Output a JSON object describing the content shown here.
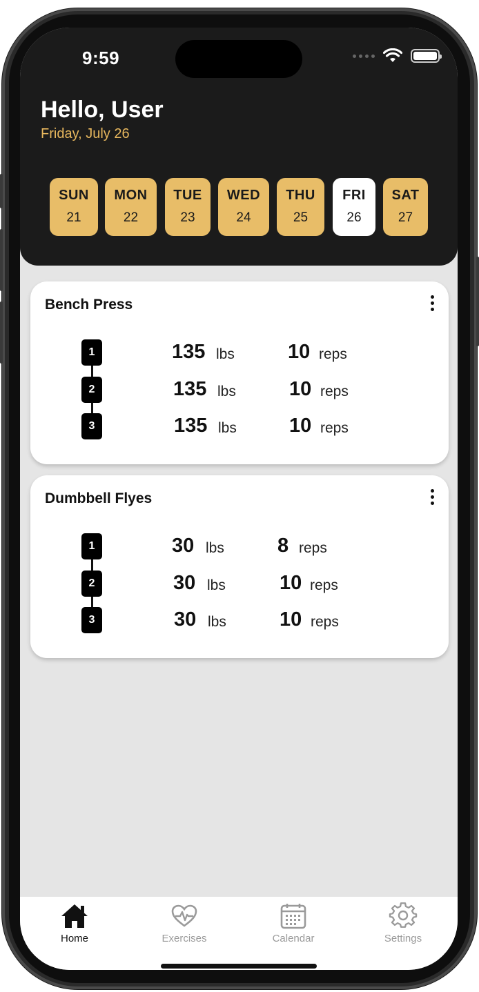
{
  "status": {
    "time": "9:59"
  },
  "header": {
    "greeting": "Hello, User",
    "date": "Friday, July 26"
  },
  "days": [
    {
      "name": "SUN",
      "num": "21"
    },
    {
      "name": "MON",
      "num": "22"
    },
    {
      "name": "TUE",
      "num": "23"
    },
    {
      "name": "WED",
      "num": "24"
    },
    {
      "name": "THU",
      "num": "25"
    },
    {
      "name": "FRI",
      "num": "26"
    },
    {
      "name": "SAT",
      "num": "27"
    }
  ],
  "selected_day": "FRI",
  "exercises": [
    {
      "title": "Bench Press",
      "sets": [
        {
          "set": "1",
          "weight": "135",
          "weight_unit": "lbs",
          "reps": "10",
          "reps_unit": "reps"
        },
        {
          "set": "2",
          "weight": "135",
          "weight_unit": "lbs",
          "reps": "10",
          "reps_unit": "reps"
        },
        {
          "set": "3",
          "weight": "135",
          "weight_unit": "lbs",
          "reps": "10",
          "reps_unit": "reps"
        }
      ]
    },
    {
      "title": "Dumbbell Flyes",
      "sets": [
        {
          "set": "1",
          "weight": "30",
          "weight_unit": "lbs",
          "reps": "8",
          "reps_unit": "reps"
        },
        {
          "set": "2",
          "weight": "30",
          "weight_unit": "lbs",
          "reps": "10",
          "reps_unit": "reps"
        },
        {
          "set": "3",
          "weight": "30",
          "weight_unit": "lbs",
          "reps": "10",
          "reps_unit": "reps"
        }
      ]
    }
  ],
  "tabs": [
    {
      "label": "Home",
      "icon": "home-icon"
    },
    {
      "label": "Exercises",
      "icon": "heart-pulse-icon"
    },
    {
      "label": "Calendar",
      "icon": "calendar-icon"
    },
    {
      "label": "Settings",
      "icon": "gear-icon"
    }
  ],
  "colors": {
    "accent": "#e8bd68",
    "header_bg": "#1b1b1b",
    "date_text": "#e8b85e",
    "screen_bg": "#e5e5e5"
  }
}
